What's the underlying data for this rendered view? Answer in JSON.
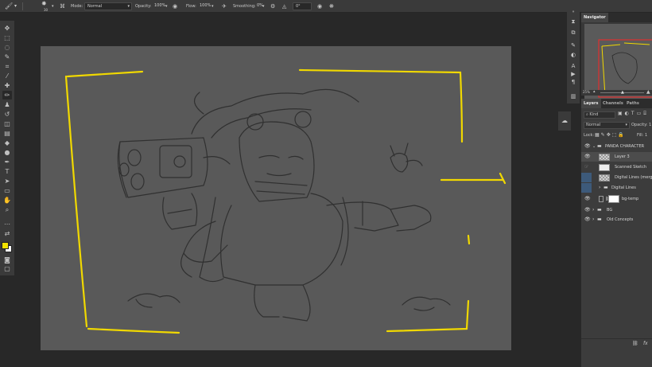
{
  "options_bar": {
    "brush_size": "30",
    "mode_label": "Mode:",
    "mode_value": "Normal",
    "opacity_label": "Opacity:",
    "opacity_value": "100%",
    "flow_label": "Flow:",
    "flow_value": "100%",
    "smoothing_label": "Smoothing:",
    "smoothing_value": "0%",
    "angle_value": "0°"
  },
  "tools": [
    {
      "icon": "move-icon",
      "glyph": "✥"
    },
    {
      "icon": "marquee-icon",
      "glyph": "⬚"
    },
    {
      "icon": "lasso-icon",
      "glyph": "◌"
    },
    {
      "icon": "quick-select-icon",
      "glyph": "✎"
    },
    {
      "icon": "crop-icon",
      "glyph": "⌗"
    },
    {
      "icon": "eyedropper-icon",
      "glyph": "⁄"
    },
    {
      "icon": "healing-icon",
      "glyph": "✚"
    },
    {
      "icon": "brush-icon",
      "glyph": "✏"
    },
    {
      "icon": "stamp-icon",
      "glyph": "♟"
    },
    {
      "icon": "history-brush-icon",
      "glyph": "↺"
    },
    {
      "icon": "eraser-icon",
      "glyph": "◫"
    },
    {
      "icon": "gradient-icon",
      "glyph": "▤"
    },
    {
      "icon": "blur-icon",
      "glyph": "◆"
    },
    {
      "icon": "dodge-icon",
      "glyph": "●"
    },
    {
      "icon": "pen-icon",
      "glyph": "✒"
    },
    {
      "icon": "type-icon",
      "glyph": "T"
    },
    {
      "icon": "path-select-icon",
      "glyph": "➤"
    },
    {
      "icon": "rectangle-icon",
      "glyph": "▭"
    },
    {
      "icon": "hand-icon",
      "glyph": "✋"
    },
    {
      "icon": "zoom-icon",
      "glyph": "⌕"
    },
    {
      "icon": "more-tools-icon",
      "glyph": "⋯"
    },
    {
      "icon": "edit-toolbar-icon",
      "glyph": "⇄"
    },
    {
      "icon": "quick-mask-icon",
      "glyph": "◙"
    },
    {
      "icon": "screen-mode-icon",
      "glyph": "▢"
    }
  ],
  "colors": {
    "foreground": "#f2e300",
    "background": "#ffffff",
    "sketch_yellow": "#f0d800",
    "panel": "#3c3c3c",
    "selection_blue": "#3d5a7a"
  },
  "navigator": {
    "tab": "Navigator",
    "zoom": "25%"
  },
  "layers_panel": {
    "tabs": [
      "Layers",
      "Channels",
      "Paths"
    ],
    "kind_label": "Kind",
    "blend_mode": "Normal",
    "opacity_label": "Opacity:",
    "opacity_value": "1",
    "lock_label": "Lock:",
    "fill_label": "Fill:",
    "fill_value": "1",
    "layers": [
      {
        "name": "PANDA CHARACTER",
        "type": "group"
      },
      {
        "name": "Layer 3",
        "type": "layer"
      },
      {
        "name": "Scanned Sketch",
        "type": "layer"
      },
      {
        "name": "Digital Lines (merged)",
        "type": "layer"
      },
      {
        "name": "Digital Lines",
        "type": "group"
      },
      {
        "name": "bg-temp",
        "type": "layer"
      },
      {
        "name": "BG",
        "type": "group"
      },
      {
        "name": "Old Concepts",
        "type": "group"
      }
    ]
  }
}
